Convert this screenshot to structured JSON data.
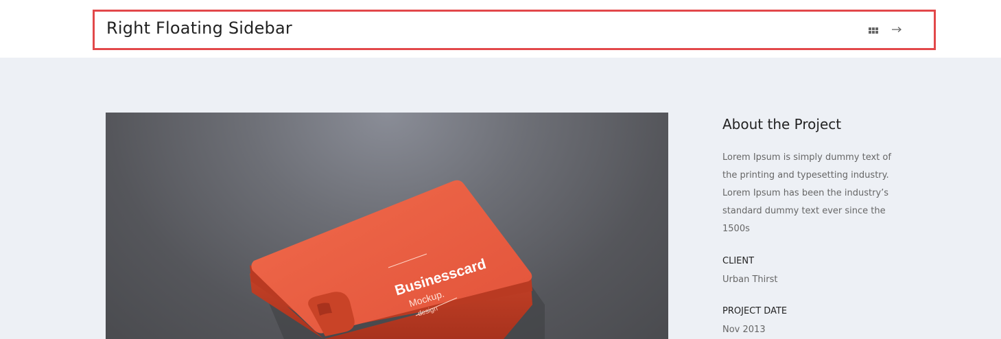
{
  "header": {
    "title": "Right Floating Sidebar",
    "grid_icon": "grid-icon",
    "next_icon": "arrow-right-icon"
  },
  "media": {
    "card_title": "Businesscard",
    "card_subtitle": "Mockup.",
    "card_tag": "design"
  },
  "sidebar": {
    "heading": "About the Project",
    "description": "Lorem Ipsum is simply dummy text of the printing and typesetting industry. Lorem Ipsum has been the industry’s standard dummy text ever since the 1500s",
    "client_label": "CLIENT",
    "client_value": "Urban Thirst",
    "date_label": "PROJECT DATE",
    "date_value": "Nov 2013"
  },
  "colors": {
    "highlight_border": "#e2484a",
    "page_background": "#edf0f5",
    "card_orange": "#e65a3e"
  }
}
